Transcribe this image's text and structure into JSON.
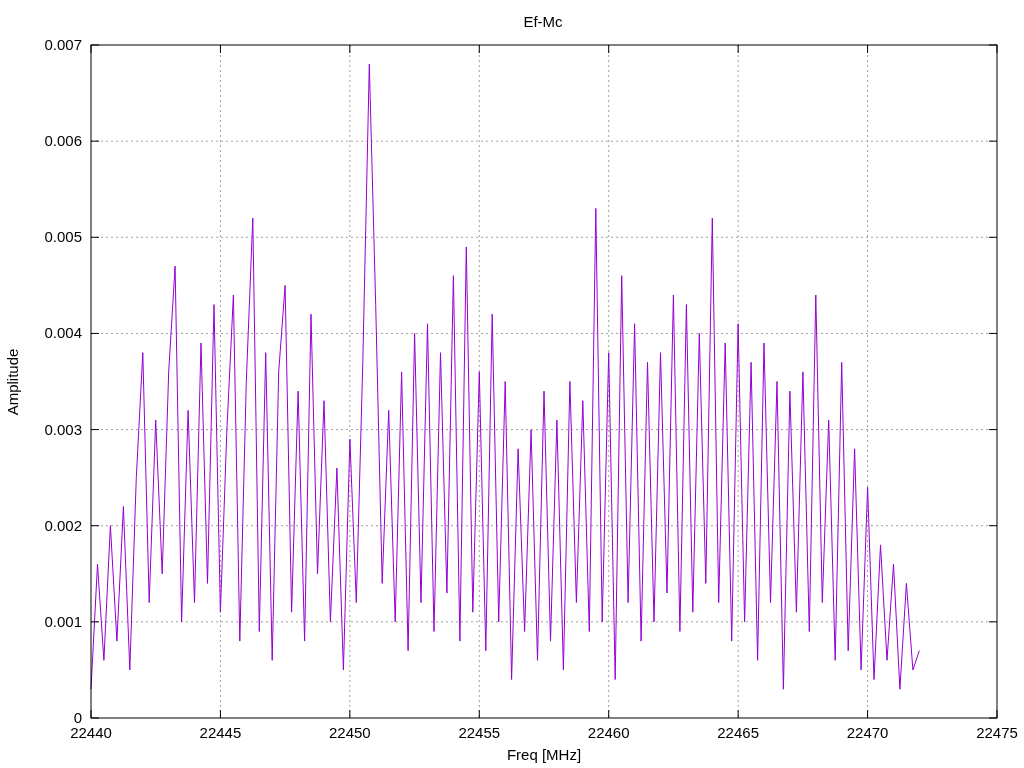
{
  "chart_data": {
    "type": "line",
    "grid": true,
    "x": [
      22440,
      22440.25,
      22440.5,
      22440.75,
      22441,
      22441.25,
      22441.5,
      22441.75,
      22442,
      22442.25,
      22442.5,
      22442.75,
      22443,
      22443.25,
      22443.5,
      22443.75,
      22444,
      22444.25,
      22444.5,
      22444.75,
      22445,
      22445.25,
      22445.5,
      22445.75,
      22446,
      22446.25,
      22446.5,
      22446.75,
      22447,
      22447.25,
      22447.5,
      22447.75,
      22448,
      22448.25,
      22448.5,
      22448.75,
      22449,
      22449.25,
      22449.5,
      22449.75,
      22450,
      22450.25,
      22450.5,
      22450.75,
      22451,
      22451.25,
      22451.5,
      22451.75,
      22452,
      22452.25,
      22452.5,
      22452.75,
      22453,
      22453.25,
      22453.5,
      22453.75,
      22454,
      22454.25,
      22454.5,
      22454.75,
      22455,
      22455.25,
      22455.5,
      22455.75,
      22456,
      22456.25,
      22456.5,
      22456.75,
      22457,
      22457.25,
      22457.5,
      22457.75,
      22458,
      22458.25,
      22458.5,
      22458.75,
      22459,
      22459.25,
      22459.5,
      22459.75,
      22460,
      22460.25,
      22460.5,
      22460.75,
      22461,
      22461.25,
      22461.5,
      22461.75,
      22462,
      22462.25,
      22462.5,
      22462.75,
      22463,
      22463.25,
      22463.5,
      22463.75,
      22464,
      22464.25,
      22464.5,
      22464.75,
      22465,
      22465.25,
      22465.5,
      22465.75,
      22466,
      22466.25,
      22466.5,
      22466.75,
      22467,
      22467.25,
      22467.5,
      22467.75,
      22468,
      22468.25,
      22468.5,
      22468.75,
      22469,
      22469.25,
      22469.5,
      22469.75,
      22470,
      22470.25,
      22470.5,
      22470.75,
      22471,
      22471.25,
      22471.5,
      22471.75,
      22472
    ],
    "series": [
      {
        "color": "#9400d3",
        "values": [
          0.0003,
          0.0016,
          0.0006,
          0.002,
          0.0008,
          0.0022,
          0.0005,
          0.0025,
          0.0038,
          0.0012,
          0.0031,
          0.0015,
          0.0036,
          0.0047,
          0.001,
          0.0032,
          0.0012,
          0.0039,
          0.0014,
          0.0043,
          0.0011,
          0.003,
          0.0044,
          0.0008,
          0.0035,
          0.0052,
          0.0009,
          0.0038,
          0.0006,
          0.0036,
          0.0045,
          0.0011,
          0.0034,
          0.0008,
          0.0042,
          0.0015,
          0.0033,
          0.001,
          0.0026,
          0.0005,
          0.0029,
          0.0012,
          0.0037,
          0.0068,
          0.0043,
          0.0014,
          0.0032,
          0.001,
          0.0036,
          0.0007,
          0.004,
          0.0012,
          0.0041,
          0.0009,
          0.0038,
          0.0013,
          0.0046,
          0.0008,
          0.0049,
          0.0011,
          0.0036,
          0.0007,
          0.0042,
          0.001,
          0.0035,
          0.0004,
          0.0028,
          0.0009,
          0.003,
          0.0006,
          0.0034,
          0.0008,
          0.0031,
          0.0005,
          0.0035,
          0.0012,
          0.0033,
          0.0009,
          0.0053,
          0.001,
          0.0038,
          0.0004,
          0.0046,
          0.0012,
          0.0041,
          0.0008,
          0.0037,
          0.001,
          0.0038,
          0.0013,
          0.0044,
          0.0009,
          0.0043,
          0.0011,
          0.004,
          0.0014,
          0.0052,
          0.0012,
          0.0039,
          0.0008,
          0.0041,
          0.001,
          0.0037,
          0.0006,
          0.0039,
          0.0012,
          0.0035,
          0.0003,
          0.0034,
          0.0011,
          0.0036,
          0.0009,
          0.0044,
          0.0012,
          0.0031,
          0.0006,
          0.0037,
          0.0007,
          0.0028,
          0.0005,
          0.0024,
          0.0004,
          0.0018,
          0.0006,
          0.0016,
          0.0003,
          0.0014,
          0.0005,
          0.0007
        ]
      }
    ],
    "title": "Ef-Mc",
    "xlabel": "Freq [MHz]",
    "ylabel": "Amplitude",
    "xlim": [
      22440,
      22475
    ],
    "ylim": [
      0,
      0.007
    ],
    "xticks": [
      {
        "value": 22440,
        "label": "22440"
      },
      {
        "value": 22445,
        "label": "22445"
      },
      {
        "value": 22450,
        "label": "22450"
      },
      {
        "value": 22455,
        "label": "22455"
      },
      {
        "value": 22460,
        "label": "22460"
      },
      {
        "value": 22465,
        "label": "22465"
      },
      {
        "value": 22470,
        "label": "22470"
      },
      {
        "value": 22475,
        "label": "22475"
      }
    ],
    "yticks": [
      {
        "value": 0.007,
        "label": "0.007"
      },
      {
        "value": 0.006,
        "label": "0.006"
      },
      {
        "value": 0.005,
        "label": "0.005"
      },
      {
        "value": 0.004,
        "label": "0.004"
      },
      {
        "value": 0.003,
        "label": "0.003"
      },
      {
        "value": 0.002,
        "label": "0.002"
      },
      {
        "value": 0.001,
        "label": "0.001"
      },
      {
        "value": 0,
        "label": "0"
      }
    ]
  }
}
